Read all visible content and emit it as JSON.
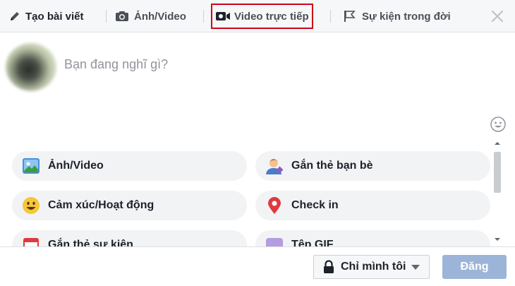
{
  "tabs": {
    "create_post": "Tạo bài viết",
    "photo_video": "Ảnh/Video",
    "live_video": "Video trực tiếp",
    "life_event": "Sự kiện trong đời"
  },
  "composer": {
    "placeholder": "Bạn đang nghĩ gì?"
  },
  "options": [
    {
      "label": "Ảnh/Video",
      "icon": "photo-icon"
    },
    {
      "label": "Gắn thẻ bạn bè",
      "icon": "tag-friends-icon"
    },
    {
      "label": "Cảm xúc/Hoạt động",
      "icon": "smiley-icon"
    },
    {
      "label": "Check in",
      "icon": "location-pin-icon"
    },
    {
      "label": "Gắn thẻ sự kiện",
      "icon": "calendar-icon"
    },
    {
      "label": "Tệp GIF",
      "icon": "gif-icon"
    }
  ],
  "footer": {
    "privacy_label": "Chỉ mình tôi",
    "post_label": "Đăng"
  },
  "colors": {
    "highlight_border": "#d0021b",
    "post_button": "#9cb4d8",
    "pill_background": "#f2f3f5"
  }
}
